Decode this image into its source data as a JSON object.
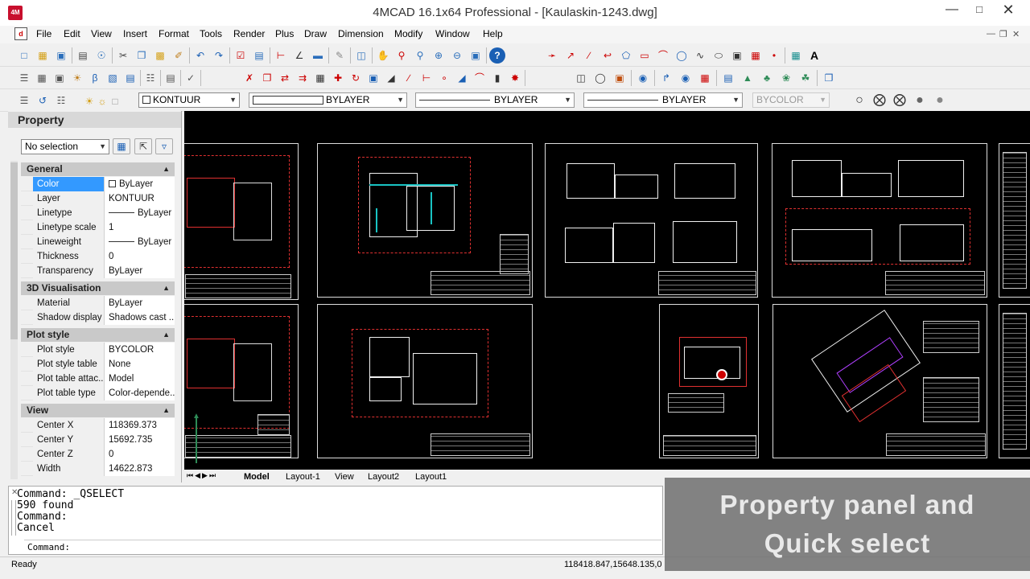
{
  "window": {
    "title": "4MCAD 16.1x64 Professional - [Kaulaskin-1243.dwg]",
    "app_icon_text": "4M"
  },
  "menu": [
    "File",
    "Edit",
    "View",
    "Insert",
    "Format",
    "Tools",
    "Render",
    "Plus",
    "Draw",
    "Dimension",
    "Modify",
    "Window",
    "Help"
  ],
  "layer_bar": {
    "layer": "KONTUUR",
    "color": "BYLAYER",
    "linetype": "BYLAYER",
    "lineweight": "BYLAYER",
    "plotstyle": "BYCOLOR"
  },
  "property_panel": {
    "title": "Property",
    "selection": "No selection",
    "sections": [
      {
        "name": "General",
        "rows": [
          {
            "name": "Color",
            "value": "ByLayer",
            "selected": true
          },
          {
            "name": "Layer",
            "value": "KONTUUR"
          },
          {
            "name": "Linetype",
            "value": "ByLayer"
          },
          {
            "name": "Linetype scale",
            "value": "1"
          },
          {
            "name": "Lineweight",
            "value": "ByLayer"
          },
          {
            "name": "Thickness",
            "value": "0"
          },
          {
            "name": "Transparency",
            "value": "ByLayer"
          }
        ]
      },
      {
        "name": "3D Visualisation",
        "rows": [
          {
            "name": "Material",
            "value": "ByLayer"
          },
          {
            "name": "Shadow display",
            "value": "Shadows cast ..."
          }
        ]
      },
      {
        "name": "Plot style",
        "rows": [
          {
            "name": "Plot style",
            "value": "BYCOLOR"
          },
          {
            "name": "Plot style table",
            "value": "None"
          },
          {
            "name": "Plot table attac...",
            "value": "Model"
          },
          {
            "name": "Plot table type",
            "value": "Color-depende..."
          }
        ]
      },
      {
        "name": "View",
        "rows": [
          {
            "name": "Center X",
            "value": "118369.373"
          },
          {
            "name": "Center Y",
            "value": "15692.735"
          },
          {
            "name": "Center Z",
            "value": "0"
          },
          {
            "name": "Width",
            "value": "14622.873"
          }
        ]
      }
    ]
  },
  "tabs": [
    "Model",
    "Layout-1",
    "View",
    "Layout2",
    "Layout1"
  ],
  "command_history": [
    "Command: _QSELECT",
    "590 found",
    "Command:",
    "Cancel"
  ],
  "command_prompt": "Command:",
  "status": {
    "text": "Ready",
    "coords": "118418.847,15648.135,0"
  },
  "banner": {
    "line1": "Property panel and",
    "line2": "Quick select"
  }
}
